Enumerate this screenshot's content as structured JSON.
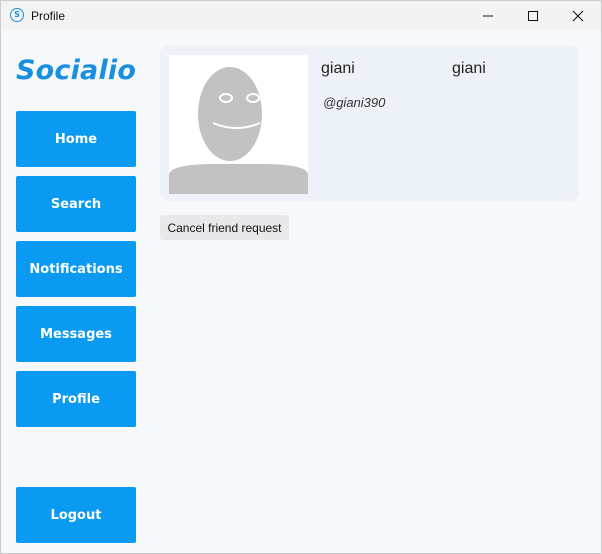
{
  "window": {
    "title": "Profile",
    "app_icon_glyph": "S"
  },
  "sidebar": {
    "logo": "Socialio",
    "items": [
      {
        "label": "Home"
      },
      {
        "label": "Search"
      },
      {
        "label": "Notifications"
      },
      {
        "label": "Messages"
      },
      {
        "label": "Profile"
      }
    ],
    "logout_label": "Logout"
  },
  "profile": {
    "first_name": "giani",
    "last_name": "giani",
    "username": "@giani390",
    "avatar_icon": "default-avatar-icon"
  },
  "actions": {
    "cancel_request_label": "Cancel friend request"
  },
  "colors": {
    "accent": "#0a9af2",
    "logo": "#1a8fe0",
    "card_bg": "#edf1f8",
    "page_bg": "#f6f8fb"
  }
}
